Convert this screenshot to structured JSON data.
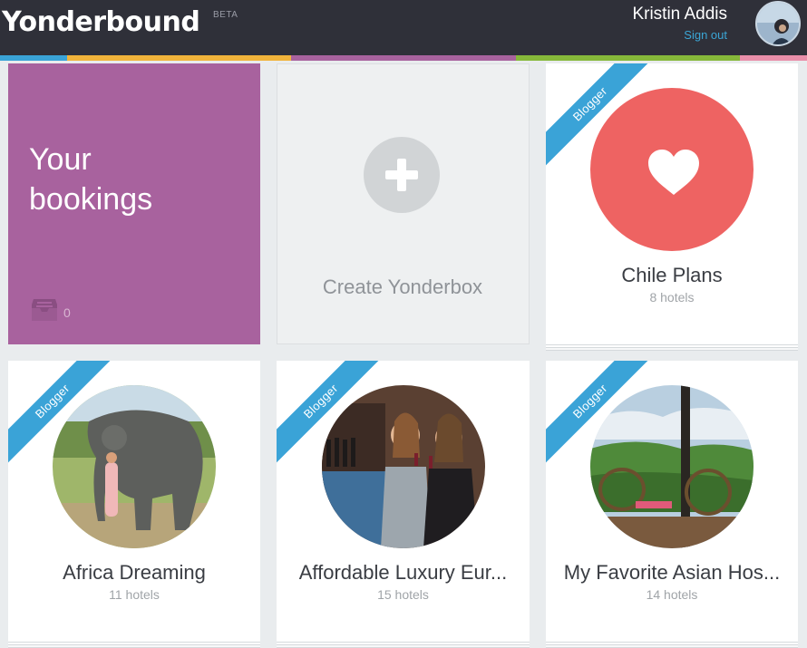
{
  "header": {
    "logo": "Yonderbound",
    "beta": "BETA",
    "user_name": "Kristin Addis",
    "sign_out": "Sign out"
  },
  "stripe_colors": [
    "#3aa3d7",
    "#f1b33b",
    "#a8629e",
    "#86b83a",
    "#e98ea9"
  ],
  "bookings": {
    "title_line1": "Your",
    "title_line2": "bookings",
    "count": "0",
    "color": "#a8629e"
  },
  "create": {
    "label": "Create Yonderbox"
  },
  "boxes": [
    {
      "title": "Chile Plans",
      "subtitle": "8 hotels",
      "ribbon": "Blogger",
      "image": "heart-icon"
    },
    {
      "title": "Africa Dreaming",
      "subtitle": "11 hotels",
      "ribbon": "Blogger",
      "image": "elephant-photo"
    },
    {
      "title": "Affordable Luxury Eur...",
      "subtitle": "15 hotels",
      "ribbon": "Blogger",
      "image": "wine-photo"
    },
    {
      "title": "My Favorite Asian Hos...",
      "subtitle": "14 hotels",
      "ribbon": "Blogger",
      "image": "hammock-photo"
    }
  ],
  "colors": {
    "ribbon": "#3aa3d7",
    "heart_circle": "#ee6362",
    "header_bg": "#2f3039"
  }
}
